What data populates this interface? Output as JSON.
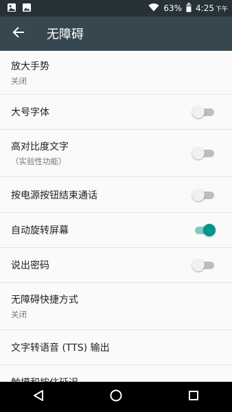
{
  "status_bar": {
    "battery": "63%",
    "time": "4:25",
    "ampm": "下午"
  },
  "toolbar": {
    "title": "无障碍"
  },
  "settings": [
    {
      "label": "放大手势",
      "summary": "关闭"
    },
    {
      "label": "大号字体",
      "toggle": false
    },
    {
      "label": "高对比度文字",
      "summary": "（实验性功能）",
      "toggle": false
    },
    {
      "label": "按电源按钮结束通话",
      "toggle": false
    },
    {
      "label": "自动旋转屏幕",
      "toggle": true
    },
    {
      "label": "说出密码",
      "toggle": false
    },
    {
      "label": "无障碍快捷方式",
      "summary": "关闭"
    },
    {
      "label": "文字转语音 (TTS) 输出"
    },
    {
      "label": "触摸和按住延迟"
    }
  ],
  "icons": {
    "status": [
      "image-icon",
      "photo-icon",
      "wifi-icon",
      "battery-icon"
    ],
    "toolbar": "back-arrow-icon",
    "navigation": [
      "back-triangle-icon",
      "home-circle-icon",
      "recents-square-icon"
    ]
  },
  "colors": {
    "status_bar": "#263238",
    "toolbar": "#37474f",
    "toggle_on": "#009688",
    "toggle_off": "#bdbdbd"
  }
}
